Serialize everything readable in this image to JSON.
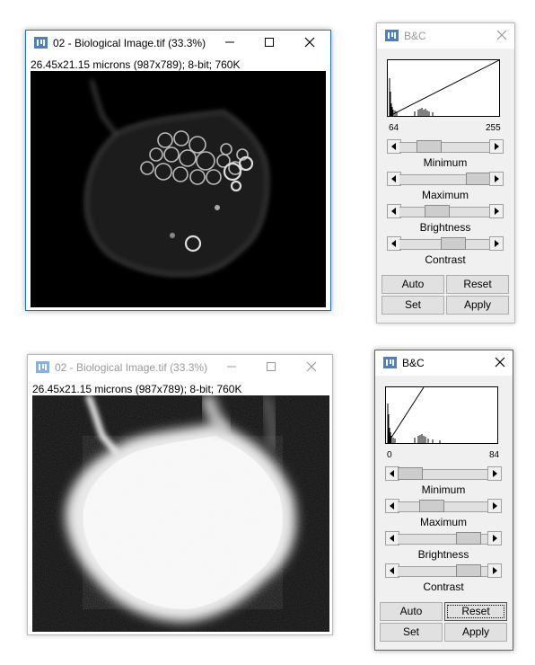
{
  "top_image_window": {
    "title": "02 - Biological Image.tif (33.3%)",
    "info": "26.45x21.15 microns (987x789); 8-bit; 760K",
    "state": "active",
    "icons": [
      "imagej-icon",
      "minimize-icon",
      "maximize-icon",
      "close-icon"
    ]
  },
  "top_bc_window": {
    "title": "B&C",
    "state": "inactive",
    "hist_min_label": "64",
    "hist_max_label": "255",
    "labels": {
      "minimum": "Minimum",
      "maximum": "Maximum",
      "brightness": "Brightness",
      "contrast": "Contrast"
    },
    "slider_positions": {
      "minimum": 0.25,
      "maximum": 1.0,
      "brightness": 0.38,
      "contrast": 0.62
    },
    "buttons": {
      "auto": "Auto",
      "reset": "Reset",
      "set": "Set",
      "apply": "Apply"
    }
  },
  "bottom_image_window": {
    "title": "02 - Biological Image.tif (33.3%)",
    "info": "26.45x21.15 microns (987x789); 8-bit; 760K",
    "state": "inactive",
    "icons": [
      "imagej-icon",
      "minimize-icon",
      "maximize-icon",
      "close-icon"
    ]
  },
  "bottom_bc_window": {
    "title": "B&C",
    "state": "active",
    "hist_min_label": "0",
    "hist_max_label": "84",
    "labels": {
      "minimum": "Minimum",
      "maximum": "Maximum",
      "brightness": "Brightness",
      "contrast": "Contrast"
    },
    "slider_positions": {
      "minimum": 0.0,
      "maximum": 0.33,
      "brightness": 0.88,
      "contrast": 0.88
    },
    "buttons": {
      "auto": "Auto",
      "reset": "Reset",
      "set": "Set",
      "apply": "Apply"
    },
    "focused_button": "reset"
  },
  "colors": {
    "active_border": "#1a6fd0",
    "panel_bg": "#f0f0f0",
    "button_bg": "#e1e1e1",
    "icon_blue": "#4a7fc1"
  }
}
